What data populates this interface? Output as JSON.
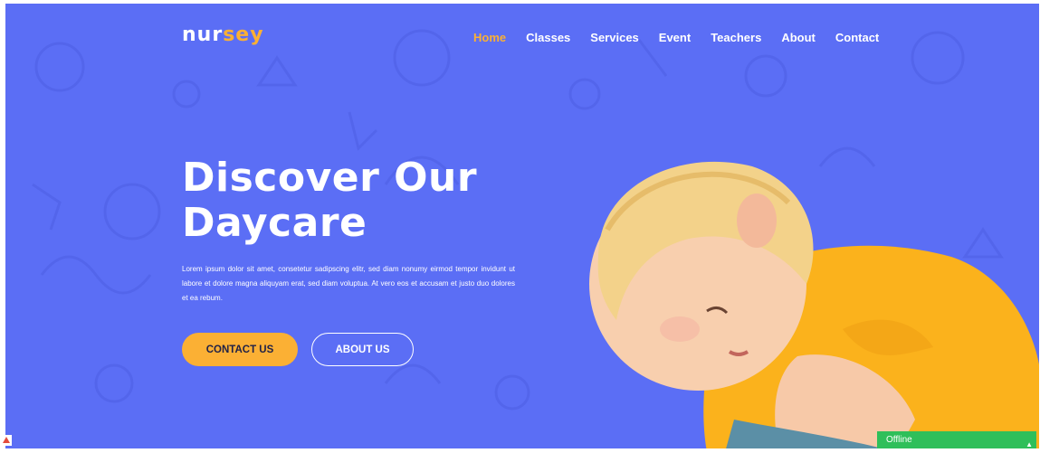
{
  "brand": {
    "logo_part1": "nur",
    "logo_part2": "sey"
  },
  "nav": {
    "items": [
      "Home",
      "Classes",
      "Services",
      "Event",
      "Teachers",
      "About",
      "Contact"
    ],
    "active": "Home"
  },
  "hero": {
    "title_line1": "Discover Our",
    "title_line2": "Daycare",
    "paragraph": "Lorem ipsum dolor sit amet, consetetur sadipscing elitr, sed diam nonumy eirmod tempor invidunt ut labore et dolore magna aliquyam erat, sed diam voluptua. At vero eos et accusam et justo duo dolores et ea rebum.",
    "contact_button": "CONTACT US",
    "about_button": "ABOUT US"
  },
  "chat": {
    "status": "Offline"
  },
  "colors": {
    "background": "#5b6ef5",
    "accent": "#fbb034",
    "text": "#ffffff",
    "button_text": "#1f2147",
    "chat": "#2fbf5a"
  }
}
